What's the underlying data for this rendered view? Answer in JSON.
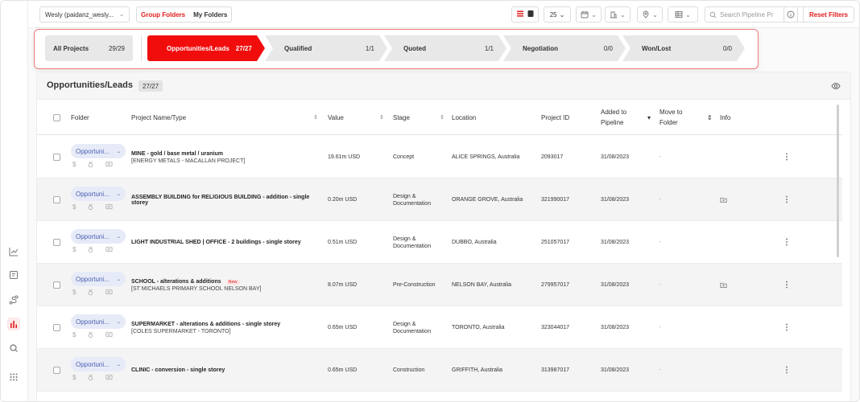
{
  "toolbar": {
    "account": "Wesly (paidanz_wesly...",
    "group_folders": "Group Folders",
    "my_folders": "My Folders",
    "per_page": "25",
    "search_placeholder": "Search Pipeline Pr",
    "reset_filters": "Reset Filters"
  },
  "pipeline": {
    "all_projects": {
      "label": "All Projects",
      "count": "29/29"
    },
    "stages": [
      {
        "label": "Opportunities/Leads",
        "count": "27/27",
        "active": true
      },
      {
        "label": "Qualified",
        "count": "1/1"
      },
      {
        "label": "Quoted",
        "count": "1/1"
      },
      {
        "label": "Negotiation",
        "count": "0/0"
      },
      {
        "label": "Won/Lost",
        "count": "0/0"
      }
    ]
  },
  "panel": {
    "title": "Opportunities/Leads",
    "count": "27/27"
  },
  "columns": {
    "folder": "Folder",
    "project": "Project Name/Type",
    "value": "Value",
    "stage": "Stage",
    "location": "Location",
    "project_id": "Project ID",
    "added_1": "Added to",
    "added_2": "Pipeline",
    "move_1": "Move to",
    "move_2": "Folder",
    "info": "Info"
  },
  "rows": [
    {
      "folder": "Opportuni...",
      "name": "MINE - gold / base metal / uranium",
      "sub": "[ENERGY METALS - MACALLAN PROJECT]",
      "new": "",
      "value": "19.61m USD",
      "stage": "Concept",
      "stage2": "",
      "location": "ALICE SPRINGS, Australia",
      "id": "2093017",
      "added": "31/08/2023",
      "move": "-",
      "info_icon": false
    },
    {
      "folder": "Opportuni...",
      "name": "ASSEMBLY BUILDING for RELIGIOUS BUILDING - addition - single storey",
      "sub": "",
      "new": "",
      "value": "0.20m USD",
      "stage": "Design &",
      "stage2": "Documentation",
      "location": "ORANGE GROVE, Australia",
      "id": "321990017",
      "added": "31/08/2023",
      "move": "-",
      "info_icon": true
    },
    {
      "folder": "Opportuni...",
      "name": "LIGHT INDUSTRIAL SHED | OFFICE - 2 buildings - single storey",
      "sub": "",
      "new": "",
      "value": "0.51m USD",
      "stage": "Design &",
      "stage2": "Documentation",
      "location": "DUBBO, Australia",
      "id": "251057017",
      "added": "31/08/2023",
      "move": "-",
      "info_icon": false
    },
    {
      "folder": "Opportuni...",
      "name": "SCHOOL - alterations & additions",
      "sub": "[ST MICHAELS PRIMARY SCHOOL NELSON BAY]",
      "new": "New",
      "value": "8.07m USD",
      "stage": "Pre-Construction",
      "stage2": "",
      "location": "NELSON BAY, Australia",
      "id": "279957017",
      "added": "31/08/2023",
      "move": "-",
      "info_icon": true
    },
    {
      "folder": "Opportuni...",
      "name": "SUPERMARKET - alterations & additions - single storey",
      "sub": "[COLES SUPERMARKET - TORONTO]",
      "new": "",
      "value": "0.65m USD",
      "stage": "Design &",
      "stage2": "Documentation",
      "location": "TORONTO, Australia",
      "id": "323044017",
      "added": "31/08/2023",
      "move": "-",
      "info_icon": false
    },
    {
      "folder": "Opportuni...",
      "name": "CLINIC - conversion - single storey",
      "sub": "",
      "new": "",
      "value": "0.65m USD",
      "stage": "Construction",
      "stage2": "",
      "location": "GRIFFITH, Australia",
      "id": "313987017",
      "added": "31/08/2023",
      "move": "-",
      "info_icon": false
    }
  ],
  "icons": [
    "chart-line-icon",
    "note-icon",
    "route-icon",
    "bar-chart-icon",
    "search-icon",
    "apps-grid-icon",
    "eye-icon",
    "dollar-icon",
    "medal-icon",
    "comment-icon",
    "folder-icon",
    "kebab-icon"
  ],
  "colors": {
    "accent": "#f20d0d",
    "folder_pill": "#e7ebf8"
  }
}
